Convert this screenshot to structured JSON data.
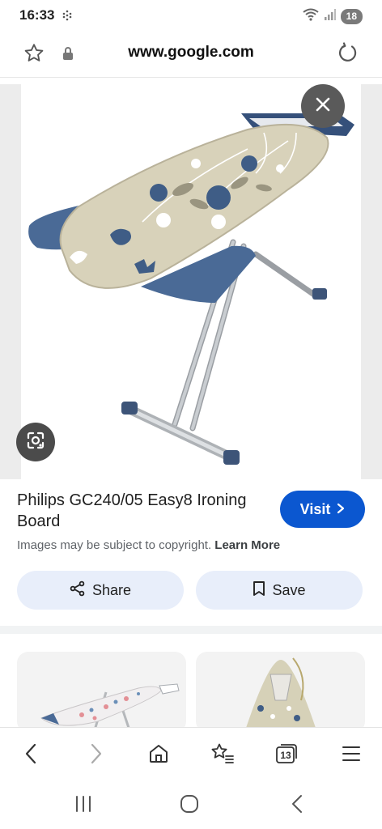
{
  "status": {
    "time": "16:33",
    "battery": "18"
  },
  "browser": {
    "url": "www.google.com"
  },
  "result": {
    "title": "Philips GC240/05 Easy8 Ironing Board",
    "visit_label": "Visit",
    "copyright_text": "Images may be subject to copyright.",
    "learn_more_label": "Learn More",
    "share_label": "Share",
    "save_label": "Save"
  },
  "toolbar": {
    "tab_count": "13"
  },
  "icons": {
    "star": "star-icon",
    "lock": "lock-icon",
    "reload": "reload-icon",
    "close": "close-icon",
    "lens": "lens-icon",
    "share": "share-icon",
    "bookmark": "bookmark-icon",
    "back": "back-icon",
    "forward": "forward-icon",
    "home": "home-icon",
    "bookmarks": "bookmarks-icon",
    "tabs": "tabs-icon",
    "menu": "menu-icon"
  },
  "colors": {
    "accent": "#0b57d0",
    "pill_bg": "#e8eefa",
    "board_fabric": "#d8d2ba",
    "board_blue": "#4a6a96"
  }
}
